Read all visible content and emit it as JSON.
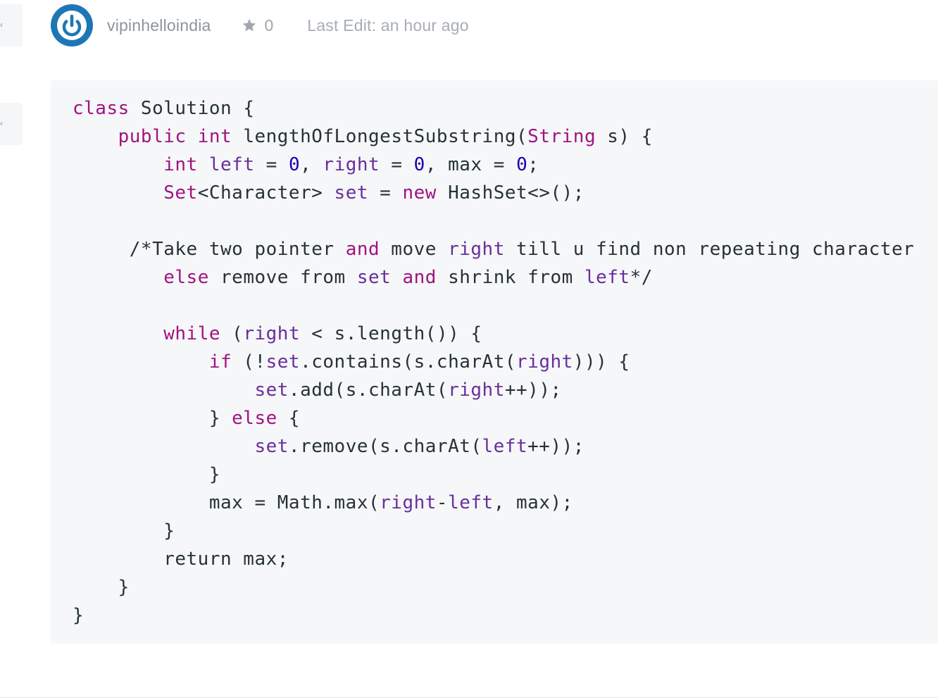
{
  "post": {
    "author": "vipinhelloindia",
    "star_count": "0",
    "last_edit": "Last Edit: an hour ago"
  },
  "vote": {
    "up_glyph": "‹",
    "down_glyph": "‹"
  },
  "code": {
    "language": "java",
    "lines": [
      "class Solution {",
      "    public int lengthOfLongestSubstring(String s) {",
      "        int left = 0, right = 0, max = 0;",
      "        Set<Character> set = new HashSet<>();",
      "",
      "     /*Take two pointer and move right till u find non repeating character",
      "        else remove from set and shrink from left*/",
      "",
      "        while (right < s.length()) {",
      "            if (!set.contains(s.charAt(right))) {",
      "                set.add(s.charAt(right++));",
      "            } else {",
      "                set.remove(s.charAt(left++));",
      "            }",
      "            max = Math.max(right-left, max);",
      "        }",
      "        return max;",
      "    }",
      "}"
    ]
  },
  "colors": {
    "keyword": "#a1137f",
    "number": "#1300b5",
    "identifier": "#6b2e9a",
    "avatar": "#1e77b5"
  }
}
